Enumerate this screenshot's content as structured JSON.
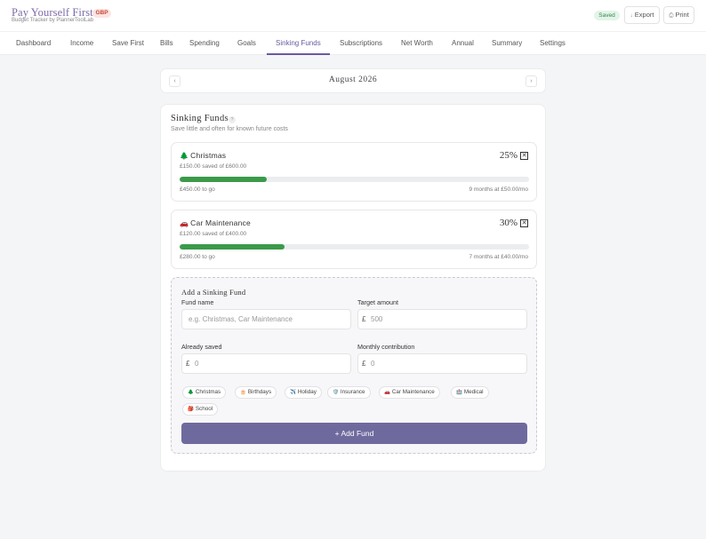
{
  "header": {
    "brand": "Pay Yourself First",
    "currency_badge": "GBP",
    "subtitle": "Budget Tracker by PlannerToolLab",
    "status": "Saved",
    "export_label": "Export",
    "print_label": "Print",
    "export_icon": "↓",
    "print_icon": "⎙"
  },
  "nav": {
    "items": [
      {
        "label": "Dashboard"
      },
      {
        "label": "Income"
      },
      {
        "label": "Save First"
      },
      {
        "label": "Bills"
      },
      {
        "label": "Spending"
      },
      {
        "label": "Goals"
      },
      {
        "label": "Sinking Funds"
      },
      {
        "label": "Subscriptions"
      },
      {
        "label": "Net Worth"
      },
      {
        "label": "Annual"
      },
      {
        "label": "Summary"
      },
      {
        "label": "Settings"
      }
    ],
    "active": "Sinking Funds"
  },
  "month": {
    "label": "August 2026",
    "prev_icon": "‹",
    "next_icon": "›"
  },
  "sinking": {
    "title": "Sinking Funds",
    "help_icon": "?",
    "description": "Save little and often for known future costs",
    "funds": [
      {
        "emoji": "🌲",
        "name": "Christmas",
        "percent_label": "25%",
        "progress": 0.25,
        "saved_text": "£150.00 saved of £600.00",
        "togo_text": "£450.00 to go",
        "months_text": "9 months at £50.00/mo",
        "delete_icon": "✕"
      },
      {
        "emoji": "🚗",
        "name": "Car Maintenance",
        "percent_label": "30%",
        "progress": 0.3,
        "saved_text": "£120.00 saved of £400.00",
        "togo_text": "£280.00 to go",
        "months_text": "7 months at £40.00/mo",
        "delete_icon": "✕"
      }
    ]
  },
  "add_form": {
    "title": "Add a Sinking Fund",
    "fund_name_label": "Fund name",
    "fund_name_placeholder": "e.g. Christmas, Car Maintenance",
    "target_label": "Target amount",
    "target_placeholder": "500",
    "already_label": "Already saved",
    "already_placeholder": "0",
    "monthly_label": "Monthly contribution",
    "monthly_placeholder": "0",
    "currency_symbol": "£",
    "presets": [
      {
        "emoji": "🌲",
        "label": "Christmas"
      },
      {
        "emoji": "🎂",
        "label": "Birthdays"
      },
      {
        "emoji": "✈️",
        "label": "Holiday"
      },
      {
        "emoji": "🛡️",
        "label": "Insurance"
      },
      {
        "emoji": "🚗",
        "label": "Car Maintenance"
      },
      {
        "emoji": "🏥",
        "label": "Medical"
      },
      {
        "emoji": "🎒",
        "label": "School"
      }
    ],
    "submit_label": "+ Add Fund"
  }
}
